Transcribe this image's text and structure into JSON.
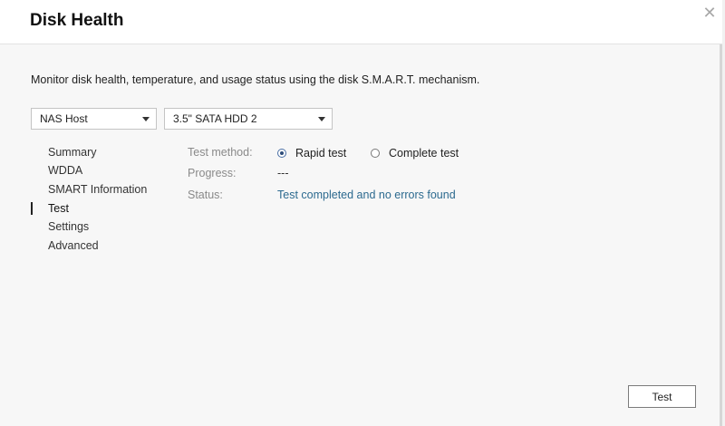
{
  "dialog": {
    "title": "Disk Health",
    "close_icon": "close-icon",
    "description": "Monitor disk health, temperature, and usage status using the disk S.M.A.R.T. mechanism."
  },
  "selectors": {
    "host": "NAS Host",
    "disk": "3.5\" SATA HDD 2"
  },
  "nav": {
    "items": [
      "Summary",
      "WDDA",
      "SMART Information",
      "Test",
      "Settings",
      "Advanced"
    ],
    "active": "Test"
  },
  "test": {
    "method_label": "Test method:",
    "method_options": [
      "Rapid test",
      "Complete test"
    ],
    "method_selected": "Rapid test",
    "progress_label": "Progress:",
    "progress_value": "---",
    "status_label": "Status:",
    "status_value": "Test completed and no errors found",
    "status_color": "#2c6a8f"
  },
  "footer": {
    "test_button": "Test"
  }
}
